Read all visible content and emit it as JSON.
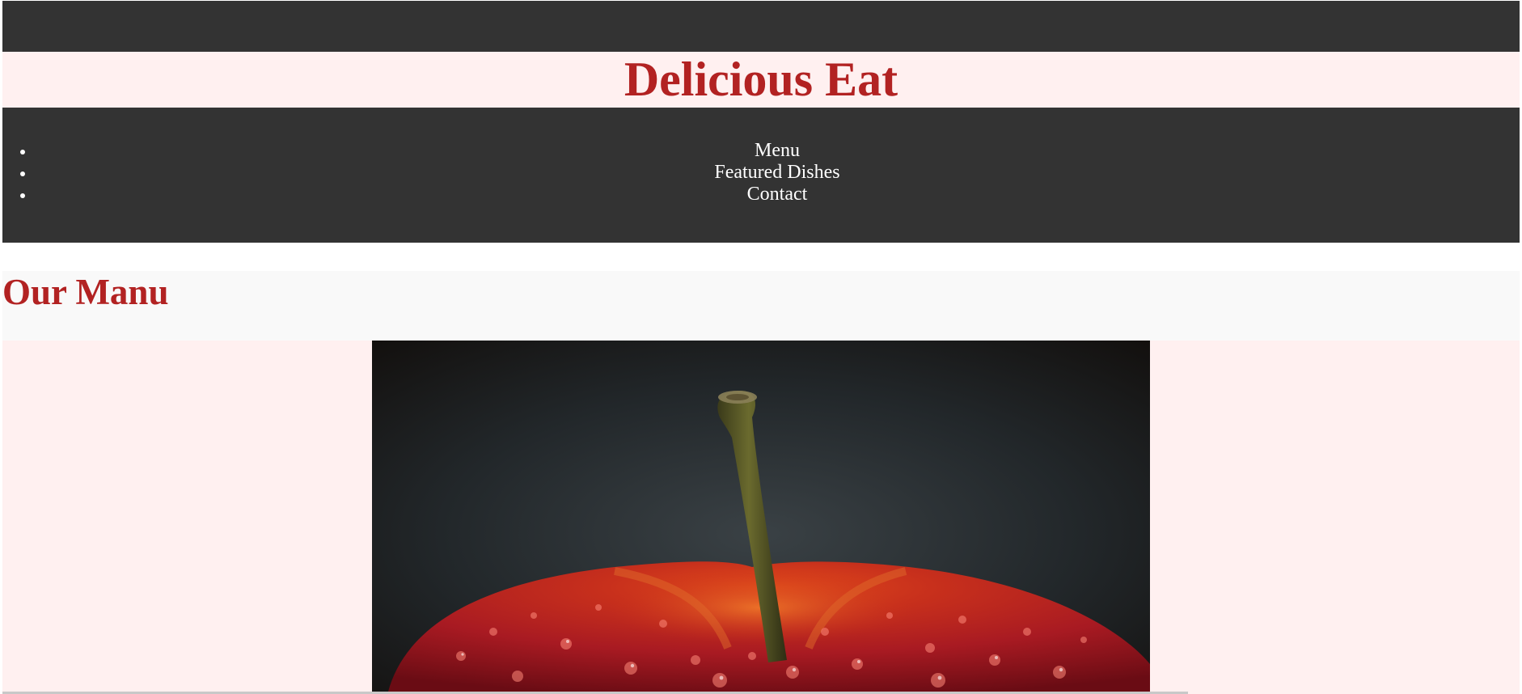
{
  "header": {
    "title": "Delicious Eat"
  },
  "nav": {
    "items": [
      {
        "label": "Menu"
      },
      {
        "label": "Featured Dishes"
      },
      {
        "label": "Contact"
      }
    ]
  },
  "menu_section": {
    "title": "Our Manu",
    "image": {
      "subject": "red apple with water droplets and stem, dark background",
      "icon": "photo-apple"
    }
  },
  "colors": {
    "dark_bar": "#333333",
    "header_bg": "#fff0f0",
    "accent_red": "#b22222",
    "section_header_bg": "#f9f9f9",
    "nav_text": "#ffffff"
  }
}
